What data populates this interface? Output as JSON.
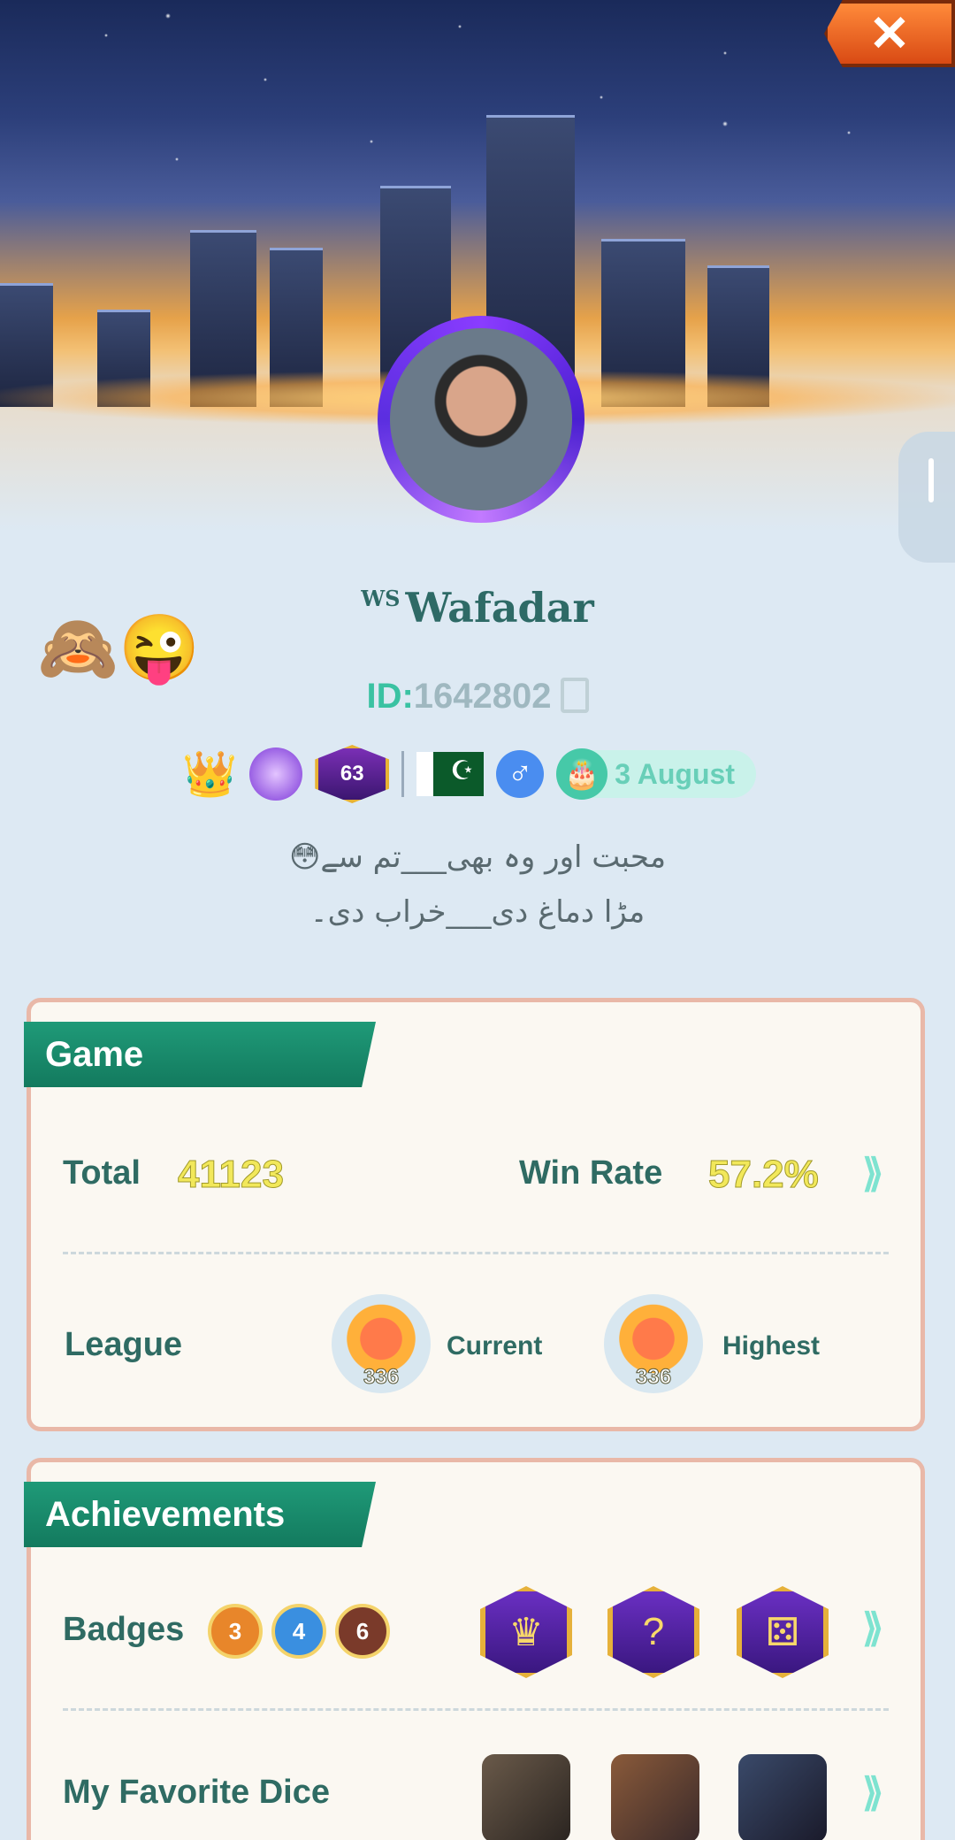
{
  "header": {
    "close_icon": "close-x-icon"
  },
  "profile": {
    "username_prefix": "WS",
    "username": "Wafadar",
    "emojis": "🙈😜",
    "id_label": "ID:",
    "id_value": "1642802",
    "level": "63",
    "birthday": "3 August",
    "gender_symbol": "♂",
    "bio_line1": "😳محبت اور وہ بھی___تم سے",
    "bio_line2": "مڑا دماغ دی___خراب دی۔"
  },
  "game": {
    "title": "Game",
    "total_label": "Total",
    "total_value": "41123",
    "winrate_label": "Win Rate",
    "winrate_value": "57.2%",
    "league_label": "League",
    "current_label": "Current",
    "current_value": "336",
    "highest_label": "Highest",
    "highest_value": "336"
  },
  "achievements": {
    "title": "Achievements",
    "badges_label": "Badges",
    "badge_counts": [
      "3",
      "4",
      "6"
    ],
    "badge_colors": [
      "#e8862a",
      "#3a8fe0",
      "#7a3a2a"
    ],
    "dice_label": "My Favorite Dice"
  },
  "chevron": "⟫"
}
